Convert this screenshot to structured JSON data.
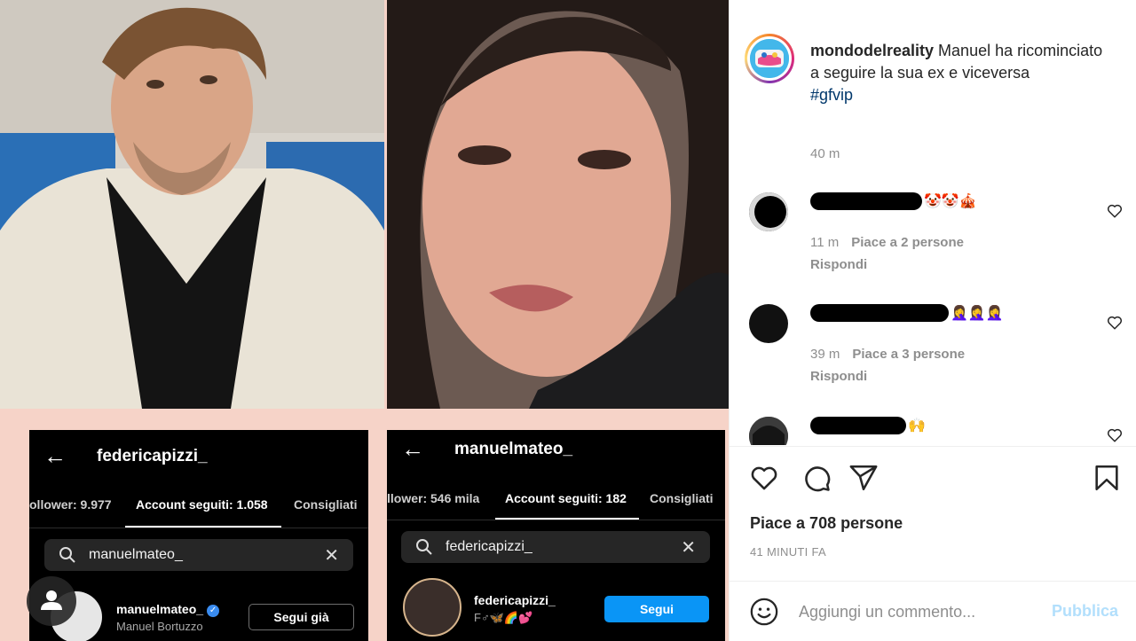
{
  "post": {
    "left_phone": {
      "username": "federicapizzi_",
      "tab_followers": "ollower: 9.977",
      "tab_following": "Account seguiti: 1.058",
      "tab_suggested": "Consigliati",
      "search_query": "manuelmateo_",
      "result_username": "manuelmateo_",
      "result_fullname": "Manuel Bortuzzo",
      "result_button": "Segui già"
    },
    "right_phone": {
      "username": "manuelmateo_",
      "tab_followers": "llower: 546 mila",
      "tab_following": "Account seguiti: 182",
      "tab_suggested": "Consigliati",
      "search_query": "federicapizzi_",
      "result_username": "federicapizzi_",
      "result_sub": "F♂🦋🌈💕",
      "result_button": "Segui"
    }
  },
  "caption": {
    "username": "mondodelreality",
    "text": "Manuel ha ricominciato a seguire la sua ex e viceversa",
    "hashtag": "#gfvip",
    "time": "40 m"
  },
  "comments": [
    {
      "emojis": "🤡🤡🎪",
      "time": "11 m",
      "likes": "Piace a 2 persone",
      "reply": "Rispondi"
    },
    {
      "emojis": "🤦‍♀️🤦‍♀️🤦‍♀️",
      "time": "39 m",
      "likes": "Piace a 3 persone",
      "reply": "Rispondi"
    },
    {
      "emojis": "🙌"
    }
  ],
  "footer": {
    "likes": "Piace a 708 persone",
    "time": "41 MINUTI FA",
    "comment_placeholder": "Aggiungi un commento...",
    "publish_label": "Pubblica"
  },
  "icons": {
    "like": "heart-icon",
    "comment": "comment-icon",
    "share": "paper-plane-icon",
    "save": "bookmark-icon",
    "emoji": "smiley-icon",
    "user_tags": "user-icon"
  },
  "colors": {
    "link_blue": "#00376b",
    "publish_disabled": "#b2dffc",
    "follow_blue": "#0a95f6",
    "media_bg": "#f6d3c8"
  }
}
